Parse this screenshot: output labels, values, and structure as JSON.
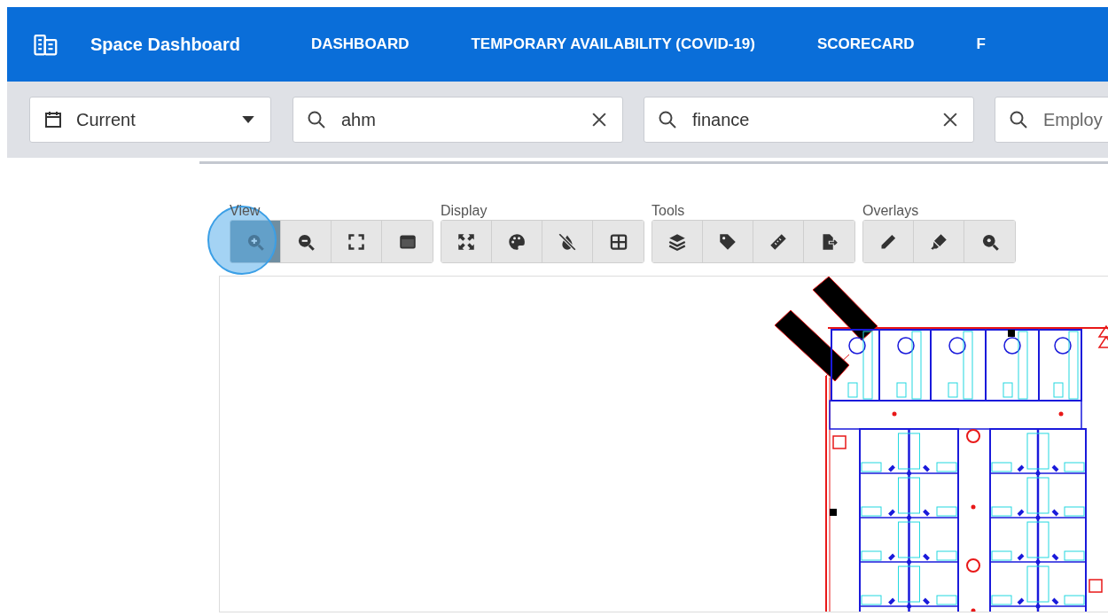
{
  "header": {
    "title": "Space Dashboard",
    "nav": [
      {
        "label": "DASHBOARD"
      },
      {
        "label": "TEMPORARY AVAILABILITY (COVID-19)"
      },
      {
        "label": "SCORECARD"
      },
      {
        "label": "F"
      }
    ]
  },
  "filters": {
    "period": {
      "value": "Current"
    },
    "searches": [
      {
        "value": "ahm"
      },
      {
        "value": "finance"
      },
      {
        "placeholder": "Employ"
      }
    ]
  },
  "toolbar": [
    {
      "label": "View",
      "buttons": [
        {
          "kind": "zoom-in",
          "selected": true
        },
        {
          "kind": "zoom-out",
          "selected": false
        },
        {
          "kind": "fit",
          "selected": false
        },
        {
          "kind": "window",
          "selected": false
        }
      ]
    },
    {
      "label": "Display",
      "buttons": [
        {
          "kind": "expand",
          "selected": false
        },
        {
          "kind": "palette",
          "selected": false
        },
        {
          "kind": "tint-off",
          "selected": false
        },
        {
          "kind": "grid",
          "selected": false
        }
      ]
    },
    {
      "label": "Tools",
      "buttons": [
        {
          "kind": "layers",
          "selected": false
        },
        {
          "kind": "tag",
          "selected": false
        },
        {
          "kind": "ruler",
          "selected": false
        },
        {
          "kind": "export",
          "selected": false
        }
      ]
    },
    {
      "label": "Overlays",
      "buttons": [
        {
          "kind": "pencil",
          "selected": false
        },
        {
          "kind": "highlighter",
          "selected": false
        },
        {
          "kind": "search-location",
          "selected": false
        }
      ]
    }
  ]
}
